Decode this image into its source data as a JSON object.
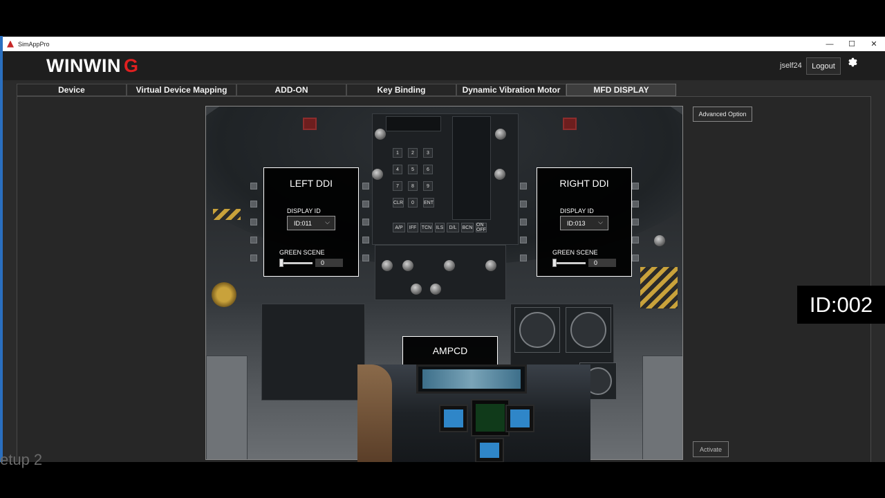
{
  "window": {
    "title": "SimAppPro",
    "controls": {
      "minimize": "—",
      "maximize": "☐",
      "close": "✕"
    }
  },
  "header": {
    "brand": "WINWIN",
    "brand_mark": "G",
    "username": "jself24",
    "logout_label": "Logout",
    "settings_icon": "gear-icon"
  },
  "tabs": [
    {
      "label": "Device",
      "active": false
    },
    {
      "label": "Virtual Device Mapping",
      "active": false
    },
    {
      "label": "ADD-ON",
      "active": false
    },
    {
      "label": "Key Binding",
      "active": false
    },
    {
      "label": "Dynamic Vibration Motor",
      "active": false
    },
    {
      "label": "MFD DISPLAY",
      "active": true
    }
  ],
  "mfd": {
    "left": {
      "title": "LEFT DDI",
      "display_id_label": "DISPLAY ID",
      "display_id_value": "ID:011",
      "green_scene_label": "GREEN SCENE",
      "green_scene_value": "0",
      "green_scene_level": 0
    },
    "right": {
      "title": "RIGHT DDI",
      "display_id_label": "DISPLAY ID",
      "display_id_value": "ID:013",
      "green_scene_label": "GREEN SCENE",
      "green_scene_value": "0",
      "green_scene_level": 0
    },
    "center": {
      "title": "AMPCD"
    }
  },
  "buttons": {
    "advanced_option": "Advanced Option",
    "activate": "Activate"
  },
  "keypad": [
    "1",
    "2",
    "3",
    "4",
    "5",
    "6",
    "7",
    "8",
    "9",
    "CLR",
    "0",
    "ENT"
  ],
  "ufc_buttons": [
    "A/P",
    "IFF",
    "TCN",
    "ILS",
    "D/L",
    "BCN",
    "ON OFF"
  ],
  "overlay": {
    "id_text": "ID:002"
  },
  "background_text": "etup 2",
  "accent_color": "#e02020"
}
